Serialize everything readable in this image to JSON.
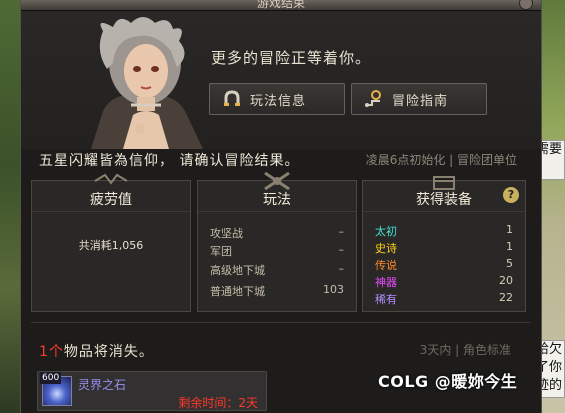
{
  "window": {
    "title": "游戏结束"
  },
  "hero": {
    "prompt": "更多的冒险正等着你。",
    "rules_button": "玩法信息",
    "guide_button": "冒险指南"
  },
  "confirm": {
    "text": "五星闪耀皆為信仰，  请确认冒险结果。",
    "reset_note": "凌晨6点初始化 | 冒险团单位"
  },
  "fatigue": {
    "header": "疲劳值",
    "total": "共消耗1,056"
  },
  "play": {
    "header": "玩法",
    "rows": [
      {
        "name": "攻坚战",
        "value": "–"
      },
      {
        "name": "军团",
        "value": "–"
      },
      {
        "name": "高级地下城",
        "value": "–"
      },
      {
        "name": "普通地下城",
        "value": "103"
      }
    ]
  },
  "gear": {
    "header": "获得装备",
    "help": "?",
    "rows": [
      {
        "name": "太初",
        "value": "1",
        "color": "#44e0d0"
      },
      {
        "name": "史诗",
        "value": "1",
        "color": "#ffd11a"
      },
      {
        "name": "传说",
        "value": "5",
        "color": "#ff8a2a"
      },
      {
        "name": "神器",
        "value": "20",
        "color": "#e84bff"
      },
      {
        "name": "稀有",
        "value": "22",
        "color": "#b48cff"
      }
    ]
  },
  "expiring": {
    "count": "1个",
    "text": "物品将消失。",
    "note": "3天内 | 角色标准"
  },
  "item": {
    "level": "600",
    "name": "灵界之石",
    "time": "剩余时间：2天"
  },
  "side": {
    "card_top": "需要\n。",
    "card_bottom": "恰欠\n了你\n迹的"
  },
  "watermark": {
    "text": "COLG @暖妳今生"
  }
}
